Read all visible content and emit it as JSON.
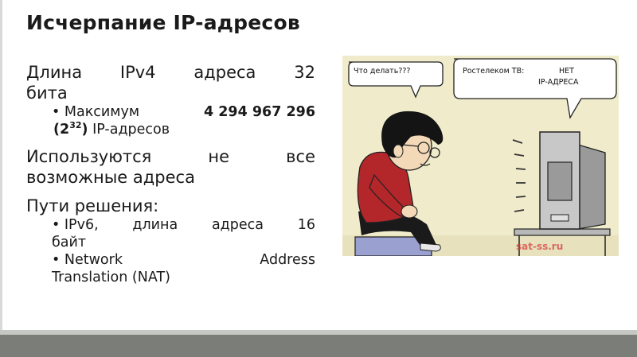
{
  "slide": {
    "title": "Исчерпание IP-адресов",
    "p1_word1": "Длина",
    "p1_word2": "IPv4",
    "p1_word3": "адреса",
    "p1_word4": "32",
    "p1_line2": "бита",
    "b1_prefix": "Максимум",
    "b1_number": "4 294 967 296",
    "b1_open": "(2",
    "b1_exp": "32",
    "b1_close": ")",
    "b1_suffix": "IP-адресов",
    "p2_word1": "Используются",
    "p2_word2": "не",
    "p2_word3": "все",
    "p2_line2": "возможные адреса",
    "p3": "Пути решения:",
    "b2_w1": "IPv6,",
    "b2_w2": "длина",
    "b2_w3": "адреса",
    "b2_w4": "16",
    "b2_line2": "байт",
    "b3_w1": "Network",
    "b3_w2": "Address",
    "b3_line2": "Translation (NAT)"
  },
  "cartoon": {
    "bubble_left": "Что делать???",
    "bubble_right_line1": "Ростелеком ТВ:",
    "bubble_right_word": "НЕТ",
    "bubble_right_line2": "IP-АДРЕСА",
    "watermark": "sat-ss.ru",
    "colors": {
      "background": "#f0eccb",
      "shirt": "#b3262a",
      "hair": "#141414",
      "monitor": "#c8c8c8",
      "floor": "#9aa0d0"
    }
  }
}
